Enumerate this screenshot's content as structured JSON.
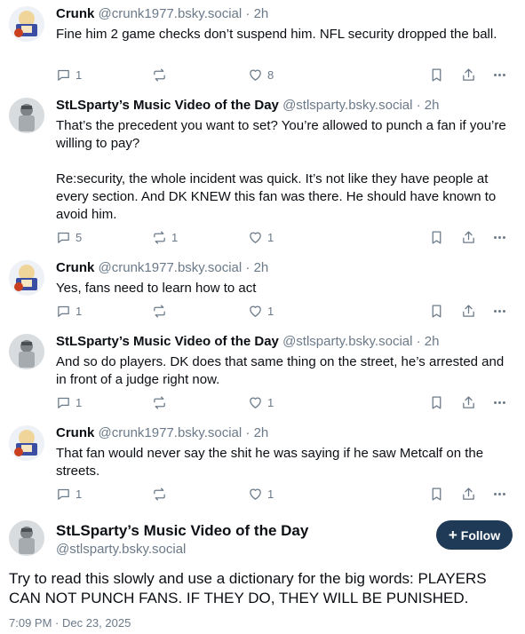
{
  "posts": [
    {
      "author": "Crunk",
      "handle": "@crunk1977.bsky.social",
      "time": "2h",
      "lines": [
        "Fine him 2 game checks don’t suspend him. NFL security dropped the ball."
      ],
      "replies": "1",
      "reposts": "",
      "likes": "8",
      "avatar": "crunk"
    },
    {
      "author": "StLSparty’s Music Video of the Day",
      "handle": "@stlsparty.bsky.social",
      "time": "2h",
      "lines": [
        "That’s the precedent you want to set? You’re allowed to punch a fan if you’re willing to pay?",
        "",
        "Re:security, the whole incident was quick. It’s not like they have people at every section. And DK KNEW this fan was there. He should have known to avoid him."
      ],
      "replies": "5",
      "reposts": "1",
      "likes": "1",
      "avatar": "sparty"
    },
    {
      "author": "Crunk",
      "handle": "@crunk1977.bsky.social",
      "time": "2h",
      "lines": [
        "Yes, fans need to learn how to act"
      ],
      "replies": "1",
      "reposts": "",
      "likes": "1",
      "avatar": "crunk"
    },
    {
      "author": "StLSparty’s Music Video of the Day",
      "handle": "@stlsparty.bsky.social",
      "time": "2h",
      "lines": [
        "And so do players.  DK does that same thing on the street, he’s arrested and in front of a judge right now."
      ],
      "replies": "1",
      "reposts": "",
      "likes": "1",
      "avatar": "sparty"
    },
    {
      "author": "Crunk",
      "handle": "@crunk1977.bsky.social",
      "time": "2h",
      "lines": [
        "That fan would never say the shit he was saying if he saw Metcalf on the streets."
      ],
      "replies": "1",
      "reposts": "",
      "likes": "1",
      "avatar": "crunk"
    }
  ],
  "main": {
    "author": "StLSparty’s Music Video of the Day",
    "handle": "@stlsparty.bsky.social",
    "follow_label": "Follow",
    "text": "Try to read this slowly and use a dictionary for the big words: PLAYERS CAN NOT PUNCH FANS. IF THEY DO, THEY WILL BE PUNISHED.",
    "timestamp": "7:09 PM · Dec 23, 2025"
  },
  "colors": {
    "muted": "#6b7a89",
    "follow_bg": "#1f3a56"
  }
}
